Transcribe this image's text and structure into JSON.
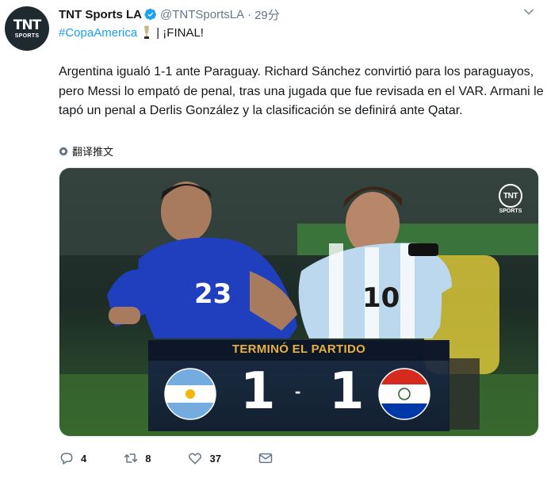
{
  "account": {
    "display_name": "TNT Sports LA",
    "handle": "@TNTSportsLA",
    "separator": "·",
    "time": "29分",
    "avatar_mark": "TNT",
    "avatar_sub": "SPORTS"
  },
  "tweet": {
    "hashtag": "#CopaAmerica",
    "title_rest": "| ¡FINAL!",
    "text": "Argentina igualó 1-1 ante Paraguay. Richard Sánchez convirtió para los paraguayos, pero Messi lo empató de penal, tras una jugada que fue revisada en el VAR. Armani le tapó un penal a Derlis González y la clasificación se definirá ante Qatar.",
    "translate_label": "翻译推文"
  },
  "media": {
    "watermark_mark": "TNT",
    "watermark_sub": "SPORTS",
    "player_left_number": "23",
    "player_right_number": "10",
    "scoreboard": {
      "status": "TERMINÓ EL PARTIDO",
      "home_score": "1",
      "separator": "-",
      "away_score": "1",
      "home_flag": "argentina-flag",
      "away_flag": "paraguay-flag"
    }
  },
  "actions": {
    "reply_count": "4",
    "retweet_count": "8",
    "like_count": "37"
  },
  "colors": {
    "link": "#1da1f2",
    "muted": "#657786",
    "scoreboard_gold": "#e8b13c"
  }
}
